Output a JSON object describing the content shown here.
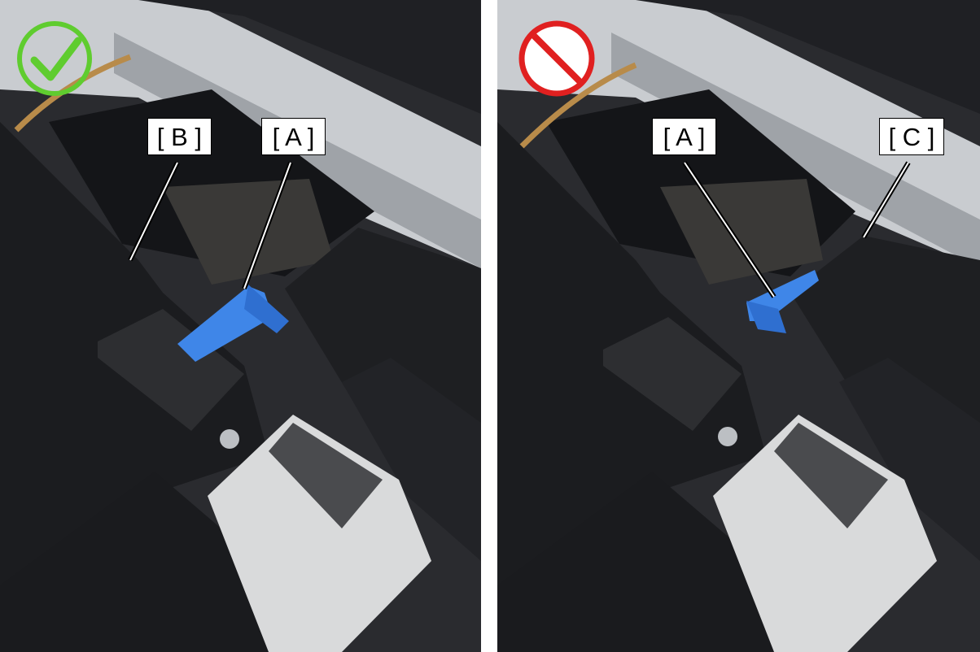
{
  "figure": {
    "left_panel": {
      "status_icon": "check-ok-icon",
      "status_color": "#5fcc2f",
      "callouts": {
        "b": "[ B ]",
        "a": "[ A ]"
      }
    },
    "right_panel": {
      "status_icon": "prohibited-icon",
      "status_color": "#e02020",
      "callouts": {
        "a": "[ A ]",
        "c": "[ C ]"
      }
    },
    "colors": {
      "lever_blue": "#3f86e8",
      "housing_black": "#1b1c1f",
      "label_gray": "#d9dadb"
    }
  }
}
